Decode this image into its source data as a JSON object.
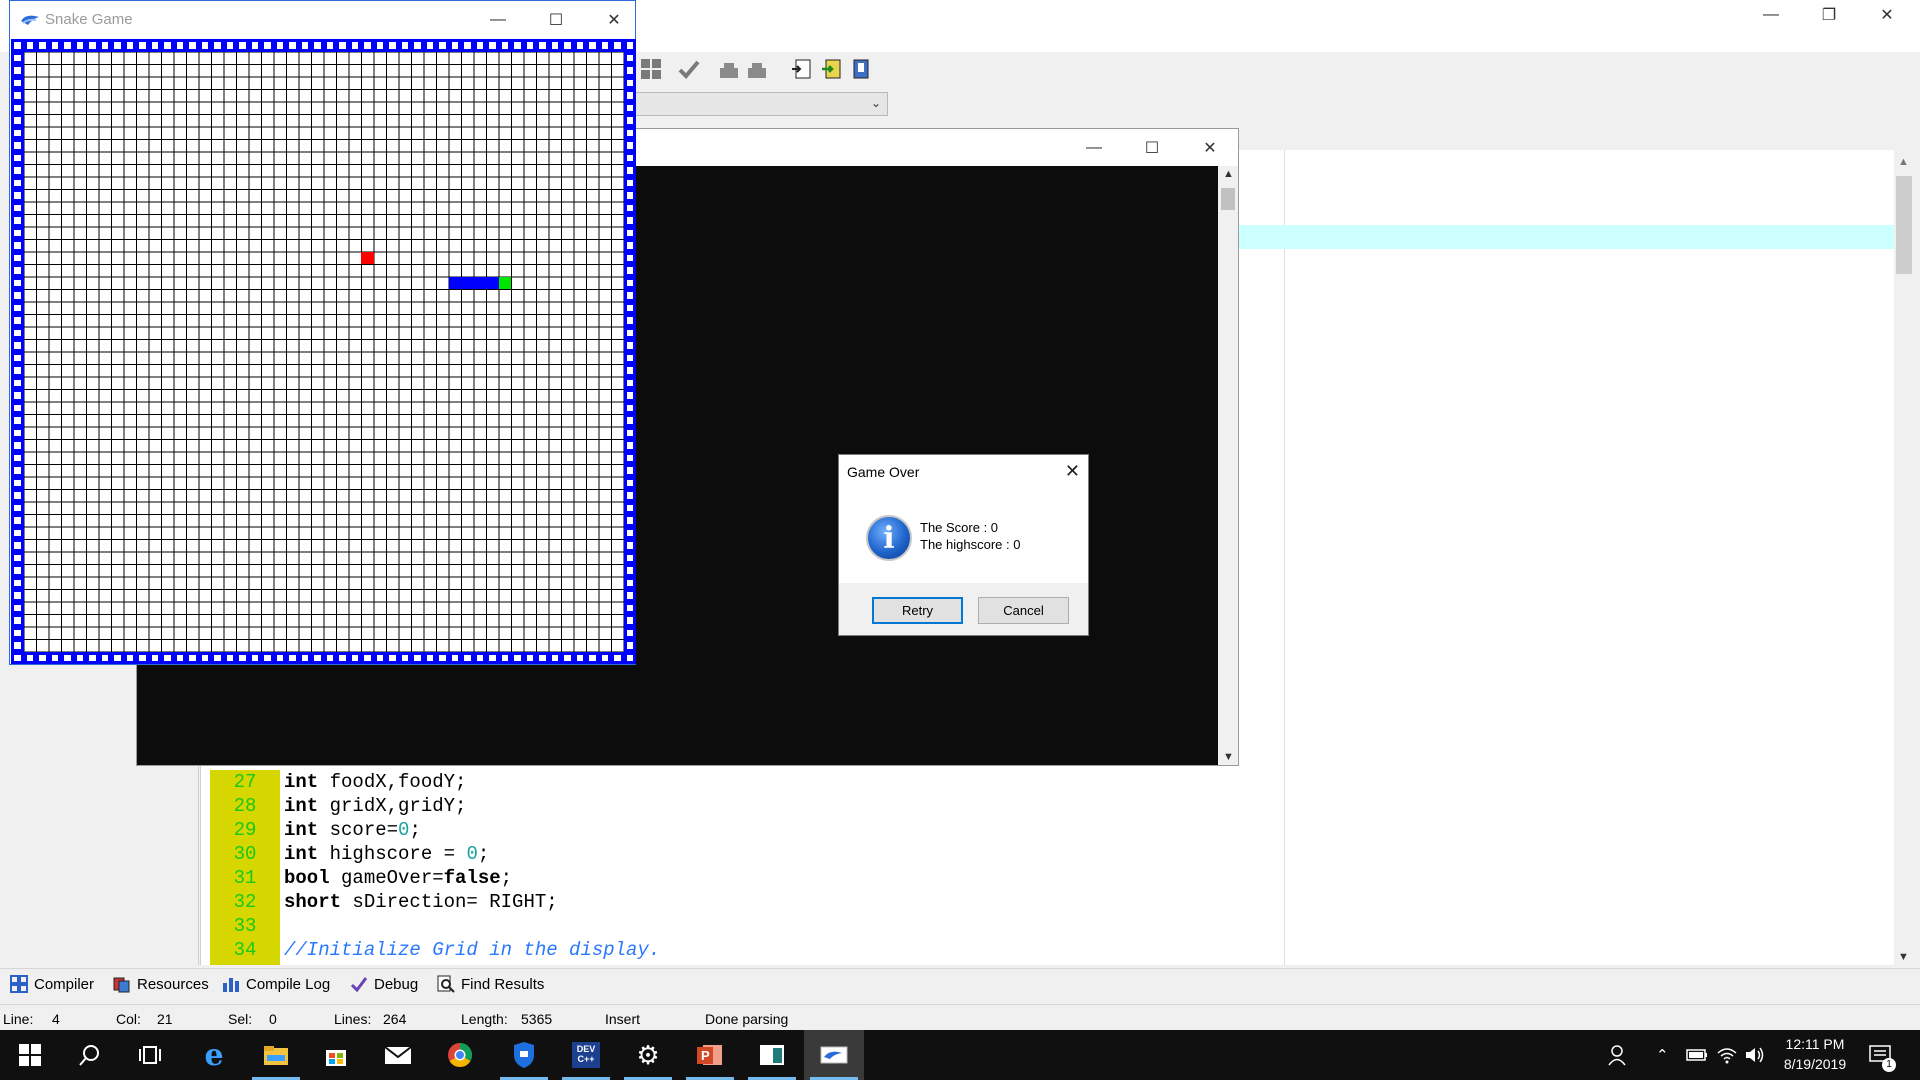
{
  "snake_window": {
    "title": "Snake Game",
    "grid_cells": 50,
    "food_color": "#ff0000",
    "snake_color": "#0000ff",
    "snake_head_color": "#00e600",
    "border_color": "#0000ff"
  },
  "dialog": {
    "title": "Game Over",
    "score_line": "The Score : 0",
    "highscore_line": "The highscore : 0",
    "retry_label": "Retry",
    "cancel_label": "Cancel"
  },
  "code": {
    "lines": [
      {
        "num": "27",
        "text": "int foodX,foodY;"
      },
      {
        "num": "28",
        "text": "int gridX,gridY;"
      },
      {
        "num": "29",
        "text": "int score=0;"
      },
      {
        "num": "30",
        "text": "int highscore = 0;"
      },
      {
        "num": "31",
        "text": "bool gameOver=false;"
      },
      {
        "num": "32",
        "text": "short sDirection= RIGHT;"
      },
      {
        "num": "33",
        "text": ""
      },
      {
        "num": "34",
        "text": "//Initialize Grid in the display."
      }
    ]
  },
  "bottom_tabs": {
    "compiler": "Compiler",
    "resources": "Resources",
    "compile_log": "Compile Log",
    "debug": "Debug",
    "find_results": "Find Results"
  },
  "status": {
    "line_label": "Line:",
    "line_value": "4",
    "col_label": "Col:",
    "col_value": "21",
    "sel_label": "Sel:",
    "sel_value": "0",
    "lines_label": "Lines:",
    "lines_value": "264",
    "length_label": "Length:",
    "length_value": "5365",
    "mode": "Insert",
    "parse_state": "Done parsing"
  },
  "taskbar": {
    "time": "12:11 PM",
    "date": "8/19/2019",
    "notification_count": "1",
    "devcpp_label": "DEV C++"
  },
  "icons": {
    "start": "windows-start-icon",
    "search": "search-icon",
    "task_view": "task-view-icon",
    "edge": "edge-icon",
    "explorer": "file-explorer-icon",
    "store": "store-icon",
    "mail": "mail-icon",
    "chrome": "chrome-icon",
    "defender": "shield-icon",
    "devcpp": "devcpp-icon",
    "settings": "gear-icon",
    "powerpoint": "powerpoint-icon",
    "app": "app-window-icon",
    "snake": "snake-game-icon"
  }
}
